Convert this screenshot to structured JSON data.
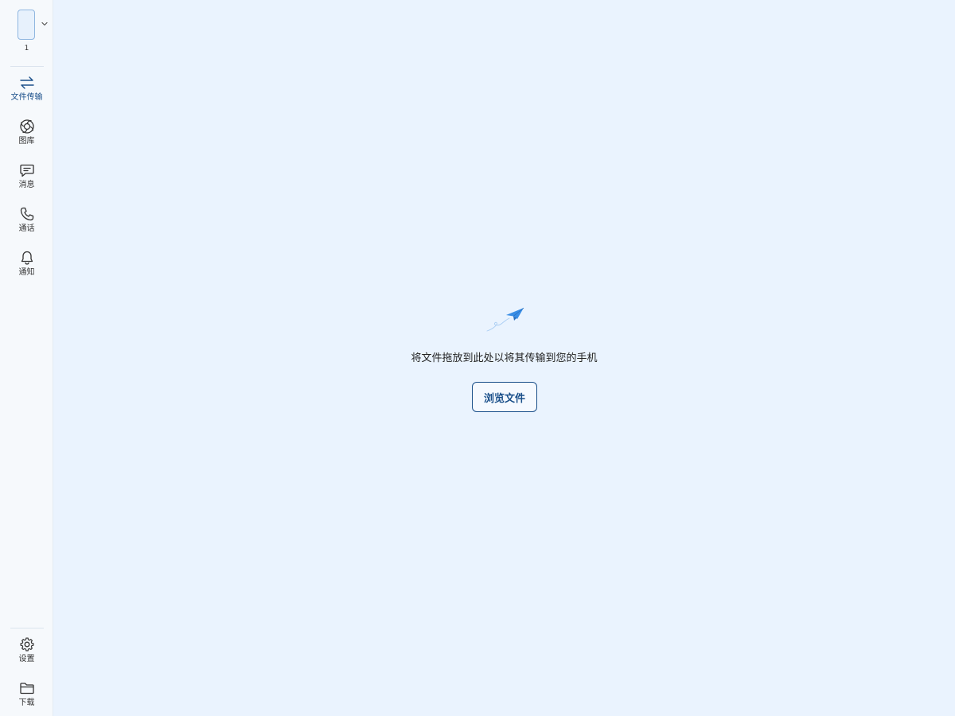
{
  "device": {
    "index": "1"
  },
  "sidebar": {
    "items": [
      {
        "label": "文件传输",
        "icon": "transfer-arrows-icon"
      },
      {
        "label": "图库",
        "icon": "aperture-icon"
      },
      {
        "label": "消息",
        "icon": "message-icon"
      },
      {
        "label": "通话",
        "icon": "phone-icon"
      },
      {
        "label": "通知",
        "icon": "bell-icon"
      }
    ],
    "bottom": [
      {
        "label": "设置",
        "icon": "gear-icon"
      },
      {
        "label": "下载",
        "icon": "folder-icon"
      }
    ]
  },
  "main": {
    "drop_text": "将文件拖放到此处以将其传输到您的手机",
    "browse_label": "浏览文件"
  },
  "colors": {
    "accent": "#1a4f8a",
    "plane": "#3a8ee6",
    "background": "#eaf3fe",
    "sidebar": "#f6f9fc"
  }
}
